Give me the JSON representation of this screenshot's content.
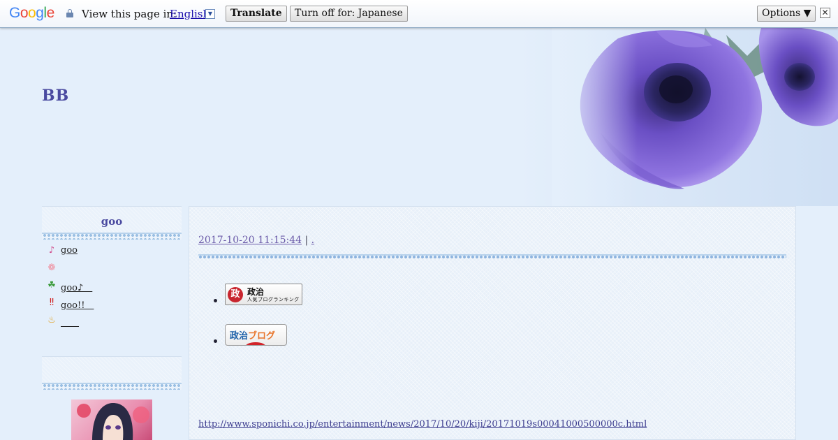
{
  "translate_bar": {
    "logo_letters": [
      {
        "ch": "G",
        "color": "#4285f4"
      },
      {
        "ch": "o",
        "color": "#ea4335"
      },
      {
        "ch": "o",
        "color": "#fbbc05"
      },
      {
        "ch": "g",
        "color": "#4285f4"
      },
      {
        "ch": "l",
        "color": "#34a853"
      },
      {
        "ch": "e",
        "color": "#ea4335"
      }
    ],
    "prompt": "View this page in:",
    "language": "English",
    "translate_label": "Translate",
    "turn_off_label": "Turn off for: Japanese",
    "options_label": "Options ▼",
    "close_glyph": "✕"
  },
  "header": {
    "blog_title": "BB"
  },
  "sidebar": {
    "box1_title": "goo",
    "items": [
      {
        "icon": "♪",
        "icon_color": "#d04a8a",
        "label": "goo"
      },
      {
        "icon": "❁",
        "icon_color": "#f08a9a",
        "label": ""
      },
      {
        "icon": "☘",
        "icon_color": "#3a9a3a",
        "label": "goo♪　"
      },
      {
        "icon": "‼",
        "icon_color": "#d02020",
        "label": "goo!!　"
      },
      {
        "icon": "♨",
        "icon_color": "#e0a020",
        "label": "　　"
      }
    ],
    "box2_title": ""
  },
  "post": {
    "timestamp": "2017-10-20 11:15:44",
    "separator": "|",
    "trailing": ".",
    "banner1": {
      "logo_char": "政",
      "title": "政治",
      "subtitle": "人気ブログランキング"
    },
    "banner2": {
      "text_blue": "政治",
      "text_orange": "ブログ"
    },
    "source_url": "http://www.sponichi.co.jp/entertainment/news/2017/10/20/kiji/20171019s00041000500000c.html"
  }
}
